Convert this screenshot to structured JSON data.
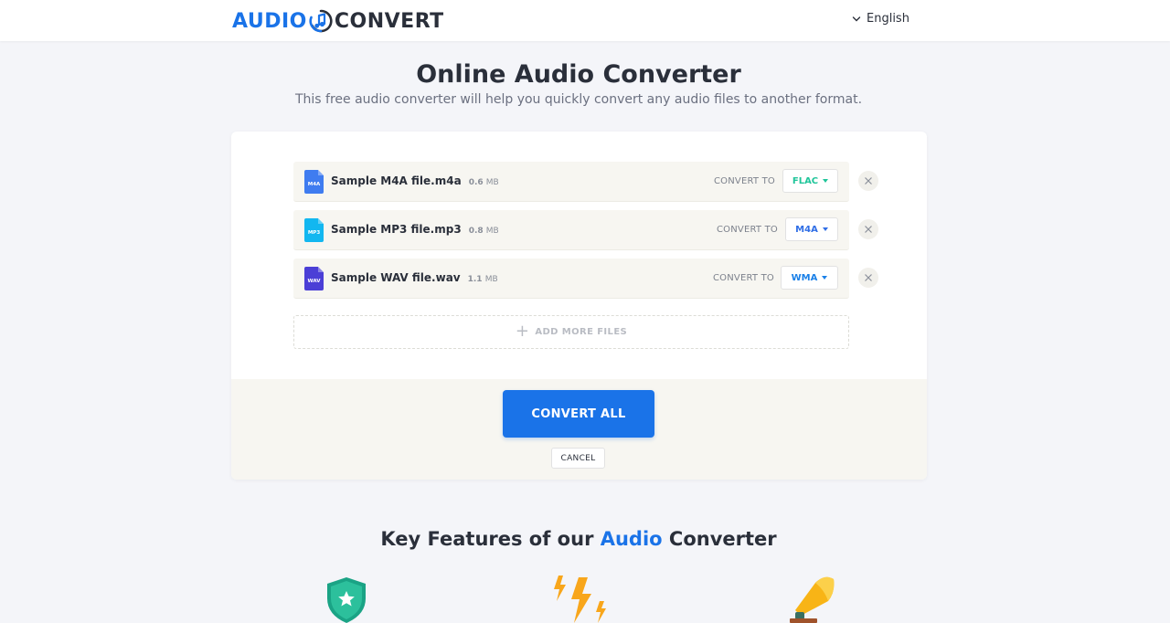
{
  "header": {
    "logo_left": "AUDIO",
    "logo_right": "CONVERT",
    "language": "English"
  },
  "main": {
    "title": "Online Audio Converter",
    "subtitle": "This free audio converter will help you quickly convert any audio files to another format."
  },
  "files": [
    {
      "name": "Sample M4A file.m4a",
      "size": "0.6",
      "unit": "MB",
      "icon_label": "M4A",
      "icon_color": "#3f7cf0",
      "convert_label": "CONVERT TO",
      "format": "FLAC",
      "format_color": "#1fc59a"
    },
    {
      "name": "Sample MP3 file.mp3",
      "size": "0.8",
      "unit": "MB",
      "icon_label": "MP3",
      "icon_color": "#12b7f0",
      "convert_label": "CONVERT TO",
      "format": "M4A",
      "format_color": "#2f6ee6"
    },
    {
      "name": "Sample WAV file.wav",
      "size": "1.1",
      "unit": "MB",
      "icon_label": "WAV",
      "icon_color": "#4b3fd6",
      "convert_label": "CONVERT TO",
      "format": "WMA",
      "format_color": "#1a80e8"
    }
  ],
  "actions": {
    "add_more": "ADD MORE FILES",
    "convert_all": "CONVERT ALL",
    "cancel": "CANCEL"
  },
  "features": {
    "title_pre": "Key Features of our",
    "title_accent": "Audio",
    "title_post": "Converter",
    "icons": [
      "shield-star-icon",
      "lightning-icon",
      "gramophone-icon"
    ]
  },
  "colors": {
    "brand": "#1a73e8",
    "text": "#2a2f3a",
    "background": "#f4f5f9"
  }
}
